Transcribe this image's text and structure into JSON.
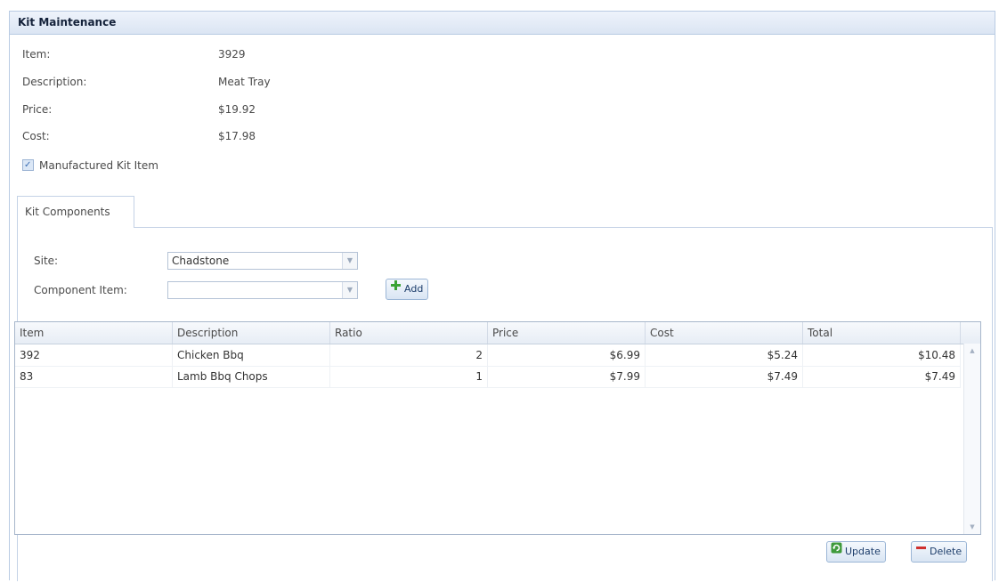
{
  "panel": {
    "title": "Kit Maintenance"
  },
  "fields": {
    "item": {
      "label": "Item:",
      "value": "3929"
    },
    "description": {
      "label": "Description:",
      "value": "Meat Tray"
    },
    "price": {
      "label": "Price:",
      "value": "$19.92"
    },
    "cost": {
      "label": "Cost:",
      "value": "$17.98"
    }
  },
  "manufactured": {
    "label": "Manufactured Kit Item",
    "checked": true
  },
  "tab": {
    "label": "Kit Components"
  },
  "site": {
    "label": "Site:",
    "value": "Chadstone"
  },
  "component": {
    "label": "Component Item:",
    "value": ""
  },
  "buttons": {
    "add": "Add",
    "update": "Update",
    "delete": "Delete"
  },
  "grid": {
    "columns": [
      "Item",
      "Description",
      "Ratio",
      "Price",
      "Cost",
      "Total"
    ],
    "rows": [
      [
        "392",
        "Chicken Bbq",
        "2",
        "$6.99",
        "$5.24",
        "$10.48"
      ],
      [
        "83",
        "Lamb Bbq Chops",
        "1",
        "$7.99",
        "$7.49",
        "$7.49"
      ]
    ]
  },
  "colors": {
    "accent": "#3b6eb3",
    "header_bg": "#dbe5f3",
    "add_icon": "#3aa335",
    "delete_icon": "#d0302e",
    "update_icon": "#3f9a3c"
  }
}
